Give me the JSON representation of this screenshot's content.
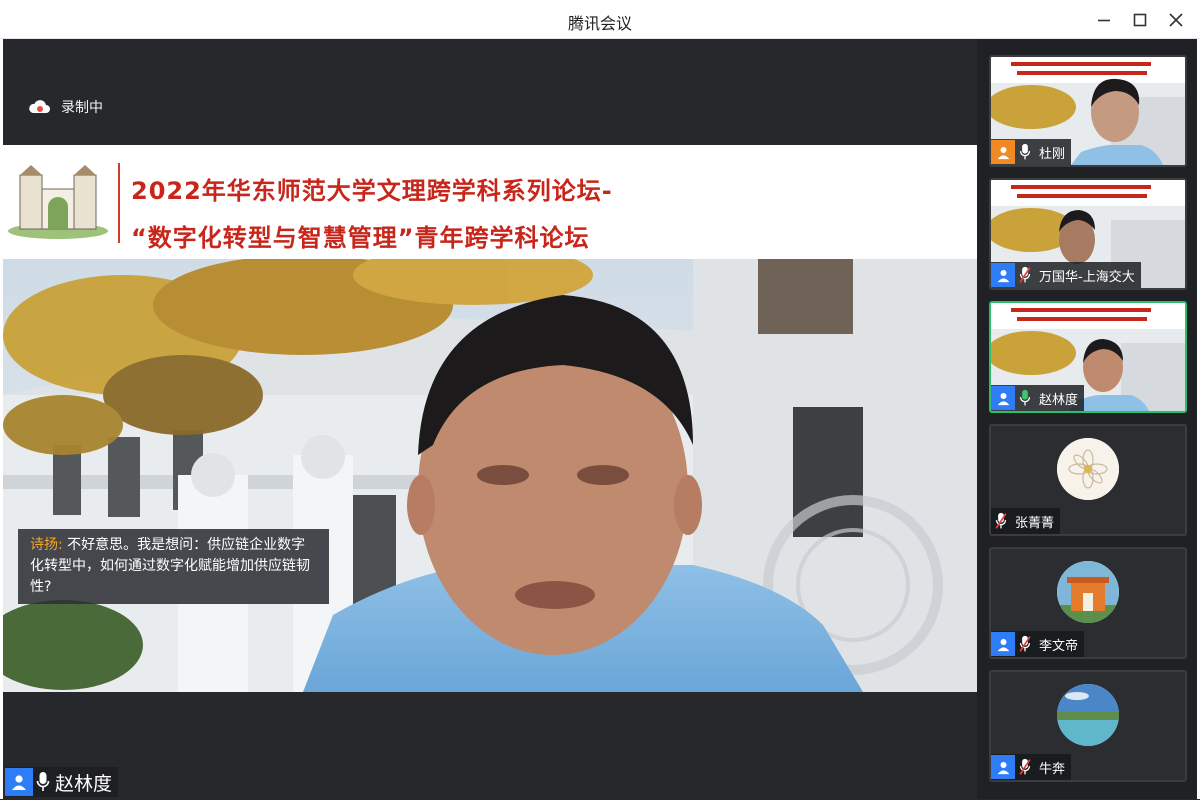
{
  "window": {
    "title": "腾讯会议"
  },
  "recording": {
    "label": "录制中"
  },
  "slide": {
    "line1": "2022年华东师范大学文理跨学科系列论坛-",
    "line2": "“数字化转型与智慧管理”青年跨学科论坛"
  },
  "caption": {
    "speaker": "诗扬:",
    "text": "不好意思。我是想问：供应链企业数字化转型中，如何通过数字化赋能增加供应链韧性?"
  },
  "active_speaker": {
    "name": "赵林度",
    "mic_state": "on"
  },
  "participants": [
    {
      "name": "杜刚",
      "avatar": "orange",
      "mic": "on",
      "video": "slide",
      "active": false
    },
    {
      "name": "万国华-上海交大",
      "avatar": "blue",
      "mic": "muted",
      "video": "slide",
      "active": false
    },
    {
      "name": "赵林度",
      "avatar": "blue",
      "mic": "on",
      "video": "slide",
      "active": true
    },
    {
      "name": "张菁菁",
      "avatar": "none",
      "mic": "muted",
      "video": "avatar-flower",
      "active": false
    },
    {
      "name": "李文帝",
      "avatar": "blue",
      "mic": "muted",
      "video": "avatar-house",
      "active": false
    },
    {
      "name": "牛奔",
      "avatar": "blue",
      "mic": "muted",
      "video": "avatar-lake",
      "active": false
    }
  ],
  "icons": {
    "minimize": "minimize-icon",
    "maximize": "maximize-icon",
    "close": "close-icon",
    "cloud": "cloud-record-icon",
    "user": "user-icon",
    "mic_on": "mic-icon",
    "mic_muted": "mic-muted-icon"
  },
  "colors": {
    "accent_blue": "#2f7df6",
    "active_border": "#2bbf6a",
    "title_red": "#c8261b",
    "caption_name": "#f5a623"
  }
}
